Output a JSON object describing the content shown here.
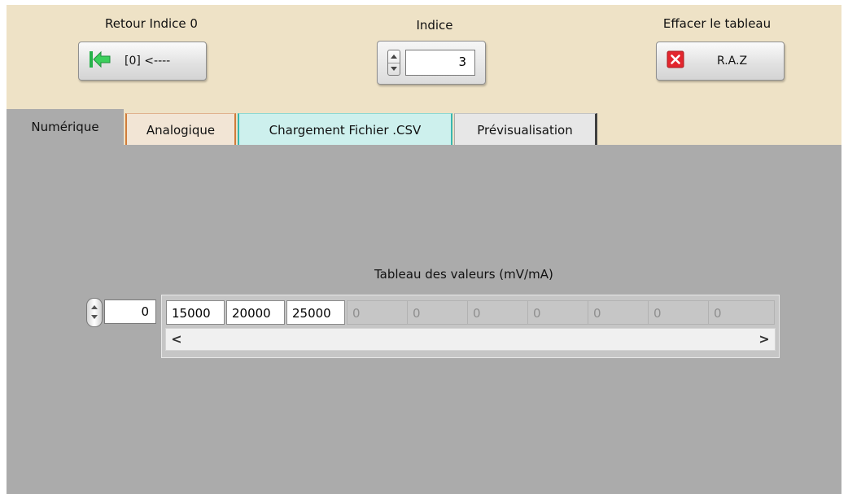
{
  "toolbar": {
    "retour": {
      "label": "Retour Indice 0",
      "button_text": "[0] <----",
      "icon": "green-left-arrow-icon"
    },
    "indice": {
      "label": "Indice",
      "value": "3"
    },
    "effacer": {
      "label": "Effacer le tableau",
      "button_text": "R.A.Z",
      "icon": "red-x-icon"
    }
  },
  "tabs": [
    {
      "label": "Numérique",
      "active": true,
      "color": "#ababab"
    },
    {
      "label": "Analogique",
      "active": false,
      "color": "#f2e5d5",
      "edge": "#d07c3a"
    },
    {
      "label": "Chargement Fichier .CSV",
      "active": false,
      "color": "#cdf0ed",
      "edge": "#38b8b0"
    },
    {
      "label": "Prévisualisation",
      "active": false,
      "color": "#e7e7e7",
      "edge": "#404040"
    }
  ],
  "panel": {
    "array_label": "Tableau des valeurs (mV/mA)",
    "array_index": "0",
    "values": [
      "15000",
      "20000",
      "25000",
      "0",
      "0",
      "0",
      "0",
      "0",
      "0",
      "0"
    ],
    "scroll_left": "<",
    "scroll_right": ">"
  },
  "colors": {
    "toolbar_bg": "#eee2c6",
    "panel_bg": "#ababab"
  }
}
